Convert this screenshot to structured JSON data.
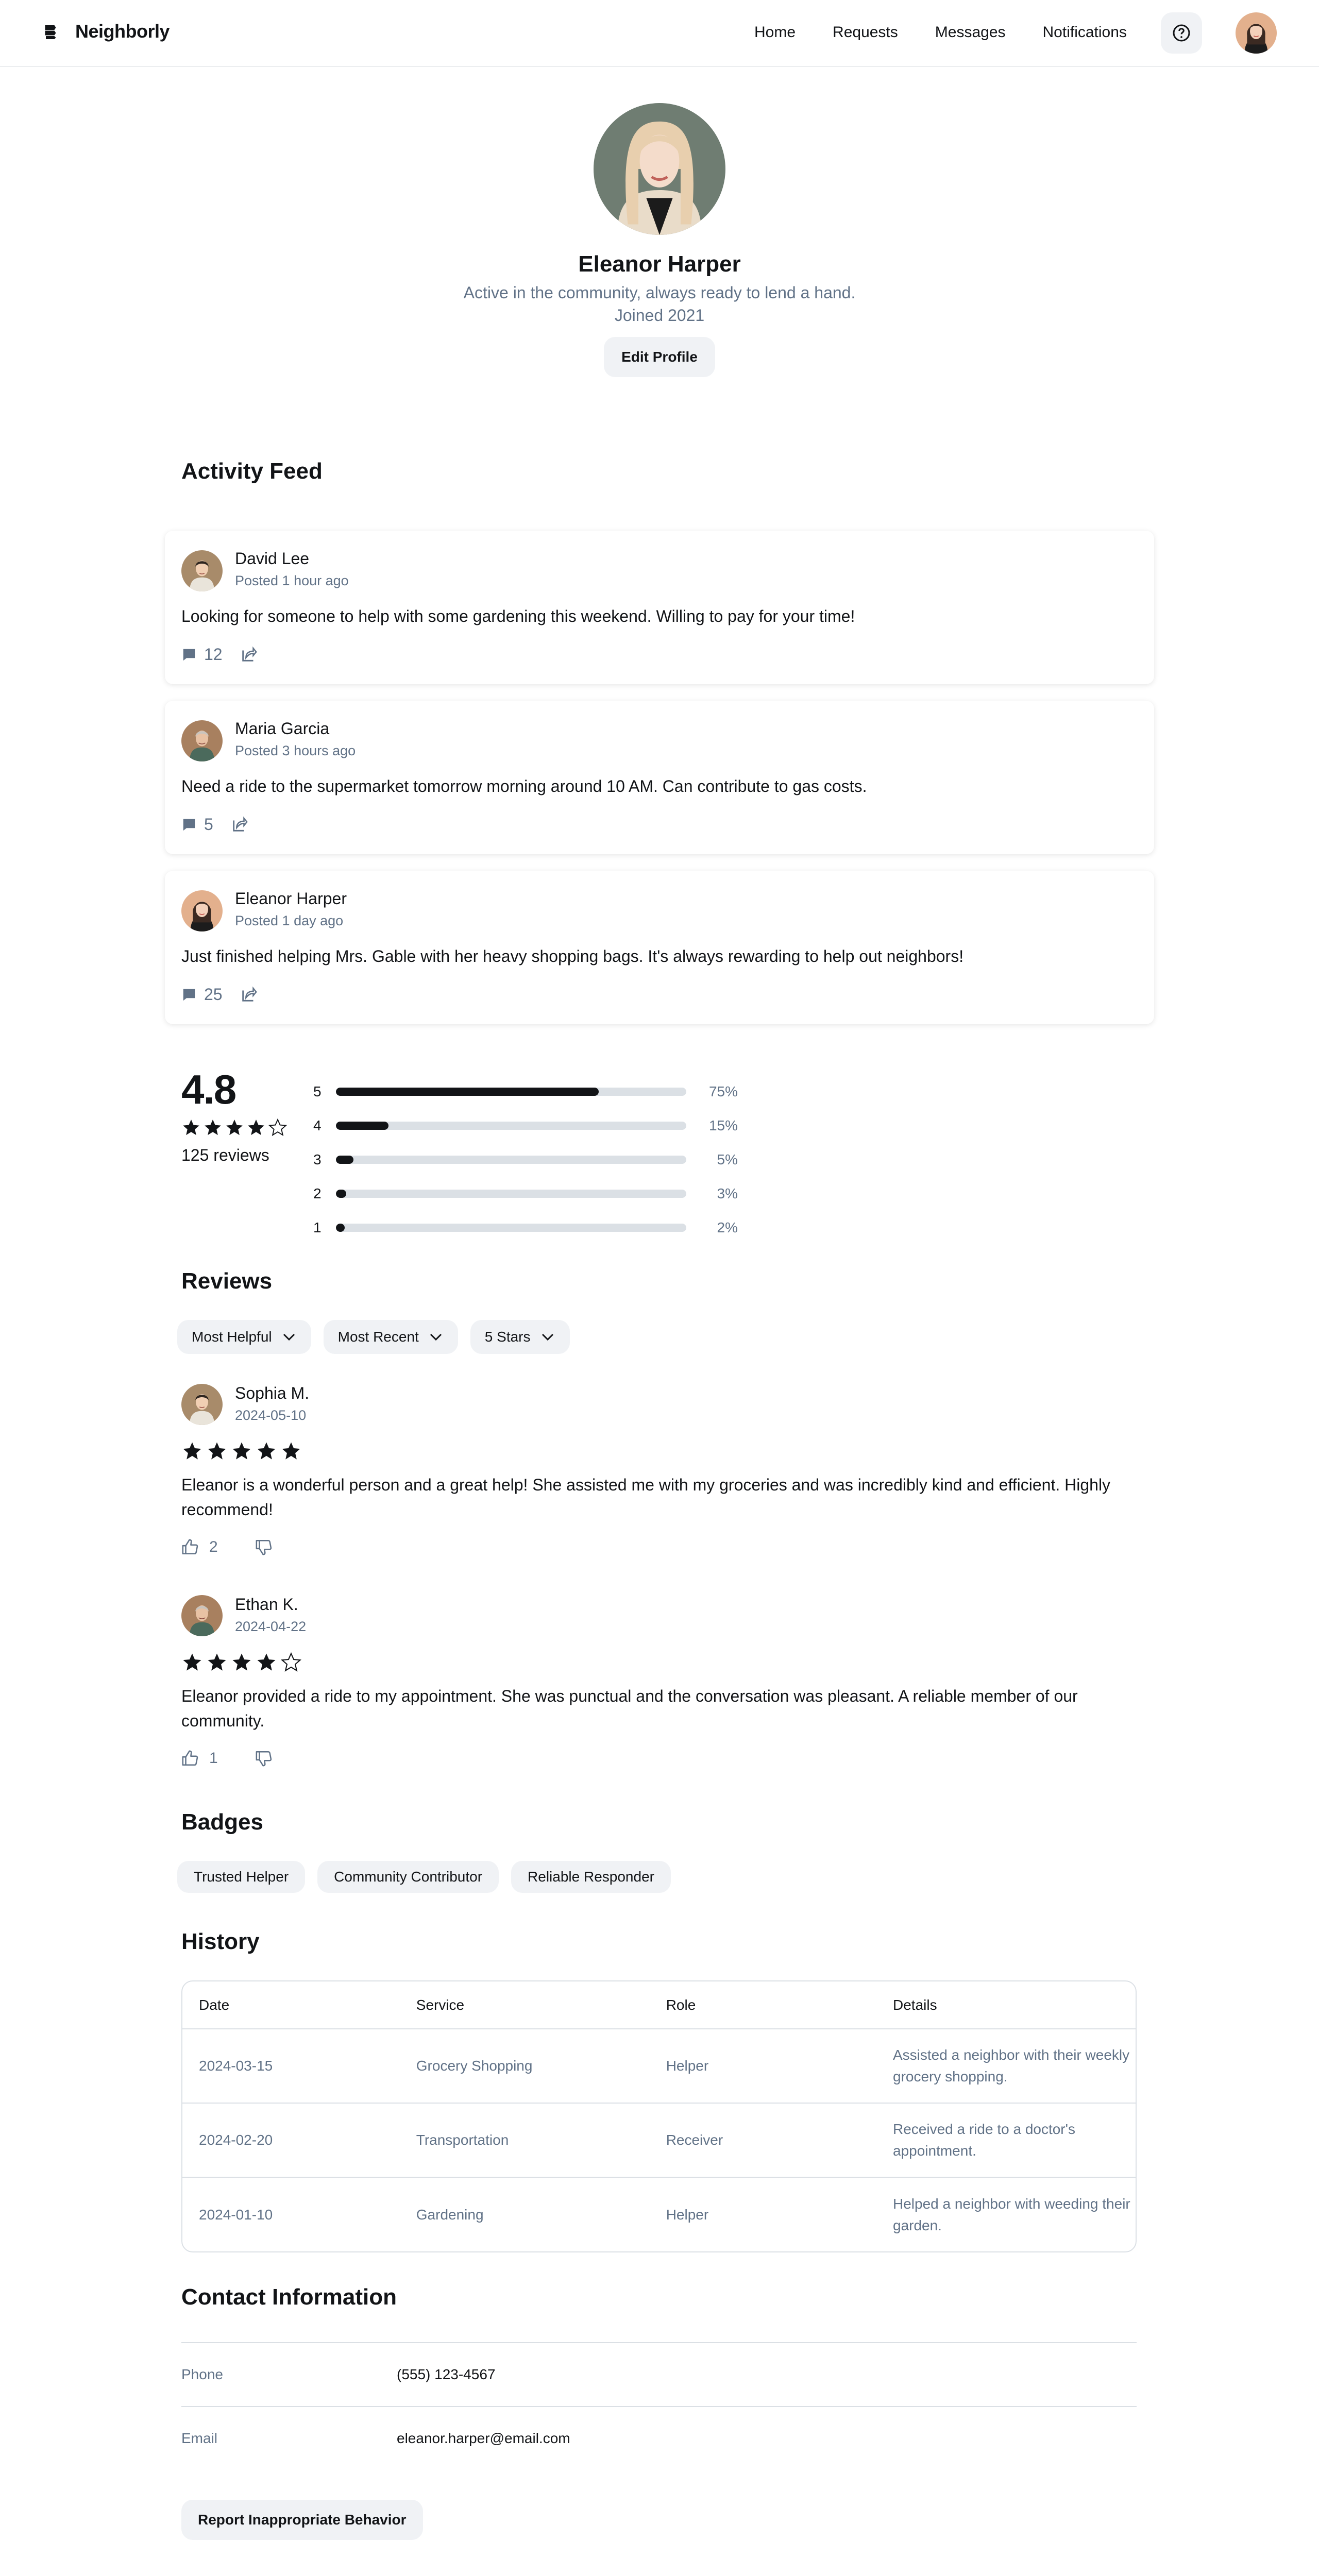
{
  "header": {
    "brand": "Neighborly",
    "nav": [
      "Home",
      "Requests",
      "Messages",
      "Notifications"
    ]
  },
  "profile": {
    "name": "Eleanor Harper",
    "bio": "Active in the community, always ready to lend a hand.",
    "joined": "Joined 2021",
    "edit_label": "Edit Profile"
  },
  "activity": {
    "title": "Activity Feed",
    "posts": [
      {
        "author": "David Lee",
        "time": "Posted 1 hour ago",
        "text": "Looking for someone to help with some gardening this weekend. Willing to pay for your time!",
        "comments": "12"
      },
      {
        "author": "Maria Garcia",
        "time": "Posted 3 hours ago",
        "text": "Need a ride to the supermarket tomorrow morning around 10 AM. Can contribute to gas costs.",
        "comments": "5"
      },
      {
        "author": "Eleanor Harper",
        "time": "Posted 1 day ago",
        "text": "Just finished helping Mrs. Gable with her heavy shopping bags. It's always rewarding to help out neighbors!",
        "comments": "25"
      }
    ]
  },
  "rating": {
    "average": "4.8",
    "stars_filled": 4,
    "count": "125 reviews",
    "distribution": [
      {
        "stars": "5",
        "percent": "75%",
        "value": 75
      },
      {
        "stars": "4",
        "percent": "15%",
        "value": 15
      },
      {
        "stars": "3",
        "percent": "5%",
        "value": 5
      },
      {
        "stars": "2",
        "percent": "3%",
        "value": 3
      },
      {
        "stars": "1",
        "percent": "2%",
        "value": 2
      }
    ]
  },
  "reviews": {
    "title": "Reviews",
    "filters": [
      "Most Helpful",
      "Most Recent",
      "5 Stars"
    ],
    "items": [
      {
        "name": "Sophia M.",
        "date": "2024-05-10",
        "rating": 5,
        "text": "Eleanor is a wonderful person and a great help! She assisted me with my groceries and was incredibly kind and efficient. Highly recommend!",
        "likes": "2"
      },
      {
        "name": "Ethan K.",
        "date": "2024-04-22",
        "rating": 4,
        "text": "Eleanor provided a ride to my appointment. She was punctual and the conversation was pleasant. A reliable member of our community.",
        "likes": "1"
      }
    ]
  },
  "badges": {
    "title": "Badges",
    "items": [
      "Trusted Helper",
      "Community Contributor",
      "Reliable Responder"
    ]
  },
  "history": {
    "title": "History",
    "columns": [
      "Date",
      "Service",
      "Role",
      "Details"
    ],
    "rows": [
      [
        "2024-03-15",
        "Grocery Shopping",
        "Helper",
        "Assisted a neighbor with their weekly grocery shopping."
      ],
      [
        "2024-02-20",
        "Transportation",
        "Receiver",
        "Received a ride to a doctor's appointment."
      ],
      [
        "2024-01-10",
        "Gardening",
        "Helper",
        "Helped a neighbor with weeding their garden."
      ]
    ]
  },
  "contact": {
    "title": "Contact Information",
    "phone_label": "Phone",
    "phone": "(555) 123-4567",
    "email_label": "Email",
    "email": "eleanor.harper@email.com"
  },
  "report_label": "Report Inappropriate Behavior",
  "colors": {
    "text": "#121417",
    "muted": "#617287",
    "chip_bg": "#f0f2f5",
    "border": "#dbe0e5"
  }
}
